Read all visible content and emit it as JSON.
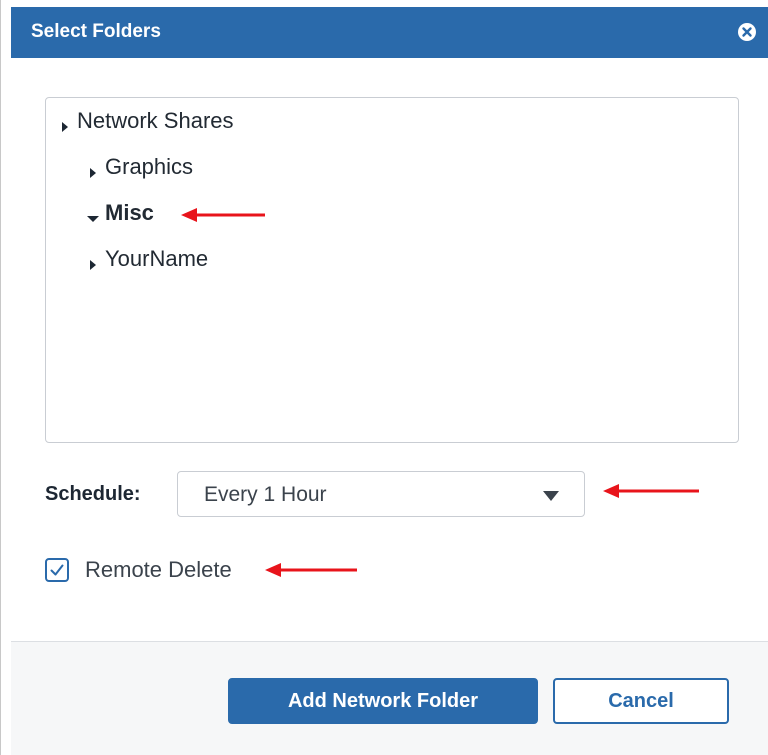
{
  "dialog": {
    "title": "Select Folders",
    "close_icon": "close-circle-icon"
  },
  "tree": {
    "nodes": [
      {
        "label": "Network Shares",
        "state": "collapsed",
        "level": 0,
        "bold": false
      },
      {
        "label": "Graphics",
        "state": "collapsed",
        "level": 1,
        "bold": false
      },
      {
        "label": "Misc",
        "state": "expanded",
        "level": 1,
        "bold": true
      },
      {
        "label": "YourName",
        "state": "collapsed",
        "level": 1,
        "bold": false
      }
    ]
  },
  "schedule": {
    "label": "Schedule:",
    "selected": "Every 1 Hour"
  },
  "remote_delete": {
    "label": "Remote Delete",
    "checked": true
  },
  "buttons": {
    "add": "Add Network Folder",
    "cancel": "Cancel"
  },
  "colors": {
    "accent": "#2a6aab",
    "annotation_arrow": "#e8141b"
  }
}
